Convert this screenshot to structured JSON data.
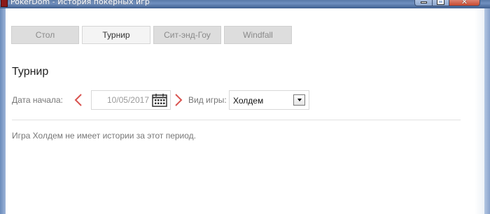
{
  "window": {
    "title": "PokerDom - История покерных игр",
    "app_icon": "pokerdom-app-icon",
    "controls": {
      "minimize_icon": "minimize-icon",
      "maximize_icon": "maximize-icon",
      "close_icon": "close-icon"
    }
  },
  "tabs": [
    {
      "label": "Стол",
      "active": false
    },
    {
      "label": "Турнир",
      "active": true
    },
    {
      "label": "Сит-энд-Гоу",
      "active": false
    },
    {
      "label": "Windfall",
      "active": false
    }
  ],
  "section": {
    "title": "Турнир"
  },
  "filters": {
    "date_label": "Дата начала:",
    "date_value": "10/05/2017",
    "prev_icon": "chevron-left-icon",
    "next_icon": "chevron-right-icon",
    "calendar_icon": "calendar-icon",
    "game_label": "Вид игры:",
    "game_value": "Холдем"
  },
  "message": "Игра Холдем не имеет истории за этот период.",
  "colors": {
    "accent_red": "#d9534f",
    "tab_bg": "#dddddd",
    "tab_active_bg": "#f4f4f4",
    "muted_text": "#777777"
  }
}
